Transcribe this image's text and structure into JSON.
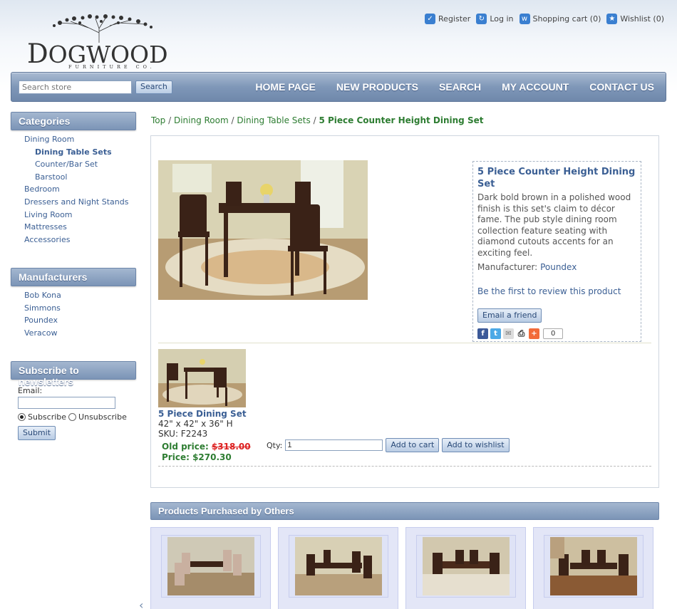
{
  "brand": {
    "name_first": "D",
    "name_rest": "OGWOOD",
    "tagline": "FURNITURE CO."
  },
  "header_links": [
    {
      "label": "Register",
      "icon": "check-icon"
    },
    {
      "label": "Log in",
      "icon": "login-icon"
    },
    {
      "label": "Shopping cart (0)",
      "icon": "cart-icon"
    },
    {
      "label": "Wishlist (0)",
      "icon": "star-icon"
    }
  ],
  "search": {
    "placeholder": "Search store",
    "button": "Search"
  },
  "nav": [
    "HOME PAGE",
    "NEW PRODUCTS",
    "SEARCH",
    "MY ACCOUNT",
    "CONTACT US"
  ],
  "categories": {
    "title": "Categories",
    "items": [
      {
        "label": "Dining Room",
        "level": 0
      },
      {
        "label": "Dining Table Sets",
        "level": 1,
        "active": true
      },
      {
        "label": "Counter/Bar Set",
        "level": 1
      },
      {
        "label": "Barstool",
        "level": 1
      },
      {
        "label": "Bedroom",
        "level": 0
      },
      {
        "label": "Dressers and Night Stands",
        "level": 0
      },
      {
        "label": "Living Room",
        "level": 0
      },
      {
        "label": "Mattresses",
        "level": 0
      },
      {
        "label": "Accessories",
        "level": 0
      }
    ]
  },
  "manufacturers": {
    "title": "Manufacturers",
    "items": [
      "Bob Kona",
      "Simmons",
      "Poundex",
      "Veracow"
    ]
  },
  "newsletter": {
    "title": "Subscribe to newsletters",
    "email_label": "Email:",
    "subscribe": "Subscribe",
    "unsubscribe": "Unsubscribe",
    "submit": "Submit"
  },
  "breadcrumb": {
    "items": [
      "Top",
      "Dining Room",
      "Dining Table Sets"
    ],
    "separator": "/",
    "current": "5 Piece Counter Height Dining Set"
  },
  "product": {
    "title": "5 Piece Counter Height Dining Set",
    "description": "Dark bold brown in a polished wood finish is this set's claim to décor fame. The pub style dining room collection feature seating with diamond cutouts accents for an exciting feel.",
    "manufacturer_label": "Manufacturer:",
    "manufacturer": "Poundex",
    "review_link": "Be the first to review this product",
    "email_friend": "Email a friend",
    "share_count": "0"
  },
  "variant": {
    "name": "5 Piece Dining Set",
    "dimensions": "42\" x 42\" x 36\" H",
    "sku": "SKU: F2243",
    "old_price_label": "Old price:",
    "old_price": "$318.00",
    "price_label": "Price:",
    "price": "$270.30",
    "qty_label": "Qty:",
    "qty_value": "1",
    "add_to_cart": "Add to cart",
    "add_to_wishlist": "Add to wishlist"
  },
  "also_purchased": {
    "title": "Products Purchased by Others",
    "count": 4
  },
  "colors": {
    "accent": "#3b5f94",
    "price_green": "#2e7d32",
    "old_price_red": "#dd2222",
    "nav_blue": "#7f97b8"
  }
}
